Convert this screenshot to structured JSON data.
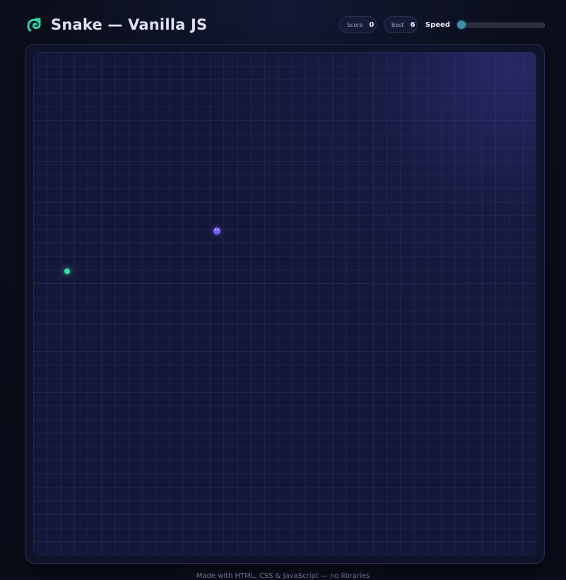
{
  "header": {
    "title": "Snake — Vanilla JS",
    "logo_icon": "snake-logo-icon",
    "accent_color": "#34d3a0"
  },
  "stats": {
    "score_label": "Score",
    "score_value": "0",
    "best_label": "Best",
    "best_value": "6"
  },
  "speed": {
    "label": "Speed",
    "value_fraction": 0.0
  },
  "board": {
    "snake_color": "#7a5cff",
    "food_color": "#34e0a0"
  },
  "footer": {
    "text": "Made with HTML, CSS & JavaScript — no libraries"
  }
}
